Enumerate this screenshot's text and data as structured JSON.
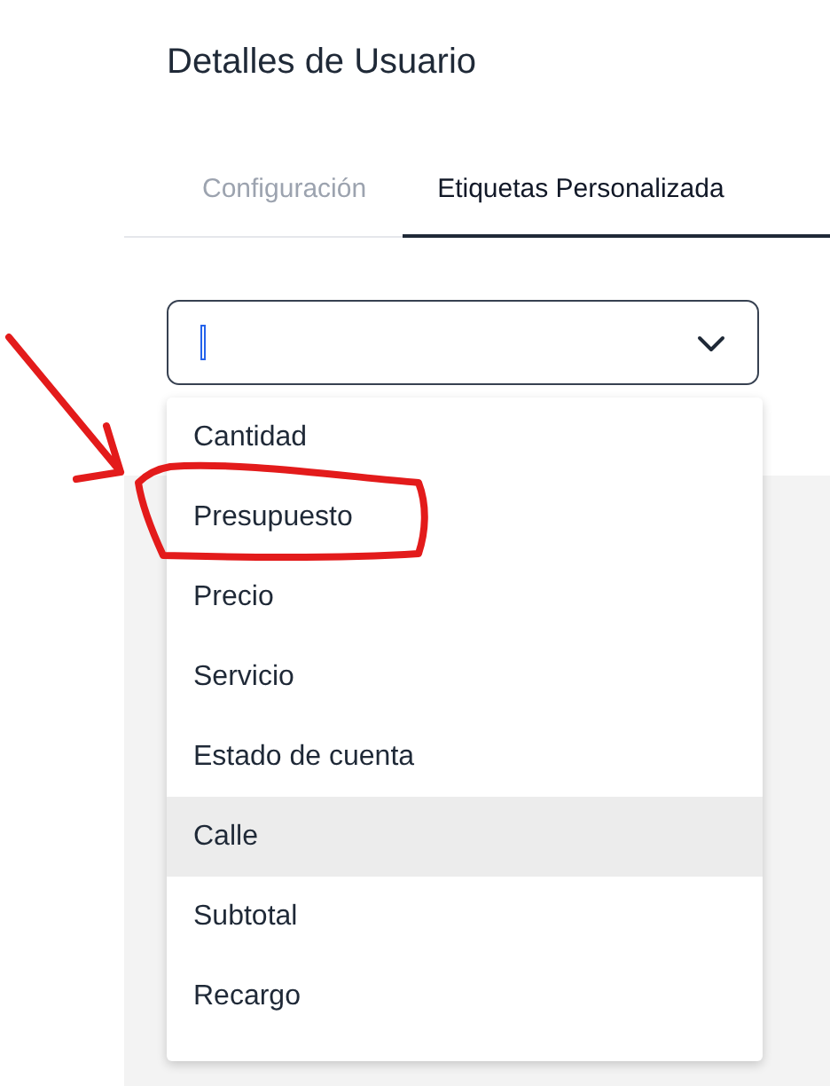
{
  "page": {
    "title": "Detalles de Usuario"
  },
  "tabs": [
    {
      "label": "Configuración",
      "selected": false
    },
    {
      "label": "Etiquetas Personalizada",
      "selected": true
    }
  ],
  "select": {
    "focused": true
  },
  "dropdown": {
    "options": [
      {
        "label": "Cantidad",
        "highlighted": false
      },
      {
        "label": "Presupuesto",
        "highlighted": false
      },
      {
        "label": "Precio",
        "highlighted": false
      },
      {
        "label": "Servicio",
        "highlighted": false
      },
      {
        "label": "Estado de cuenta",
        "highlighted": false
      },
      {
        "label": "Calle",
        "highlighted": true
      },
      {
        "label": "Subtotal",
        "highlighted": false
      },
      {
        "label": "Recargo",
        "highlighted": false
      }
    ]
  }
}
